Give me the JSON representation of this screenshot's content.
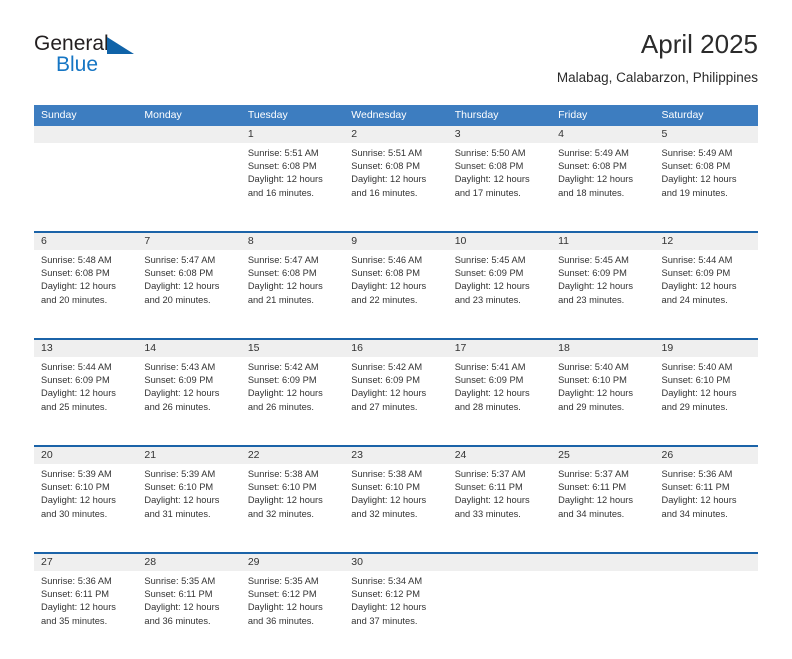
{
  "brand": {
    "name_part1": "General",
    "name_part2": "Blue"
  },
  "header": {
    "month_title": "April 2025",
    "location": "Malabag, Calabarzon, Philippines"
  },
  "colors": {
    "header_blue": "#3d7dc0",
    "divider_blue": "#1b63a8",
    "daynum_band": "#efefef",
    "logo_blue": "#1676c4",
    "text": "#333333"
  },
  "weekdays": [
    "Sunday",
    "Monday",
    "Tuesday",
    "Wednesday",
    "Thursday",
    "Friday",
    "Saturday"
  ],
  "calendar": {
    "weeks": [
      [
        {
          "day": "",
          "sunrise": "",
          "sunset": "",
          "daylight1": "",
          "daylight2": "",
          "empty": true
        },
        {
          "day": "",
          "sunrise": "",
          "sunset": "",
          "daylight1": "",
          "daylight2": "",
          "empty": true
        },
        {
          "day": "1",
          "sunrise": "Sunrise: 5:51 AM",
          "sunset": "Sunset: 6:08 PM",
          "daylight1": "Daylight: 12 hours",
          "daylight2": "and 16 minutes.",
          "empty": false
        },
        {
          "day": "2",
          "sunrise": "Sunrise: 5:51 AM",
          "sunset": "Sunset: 6:08 PM",
          "daylight1": "Daylight: 12 hours",
          "daylight2": "and 16 minutes.",
          "empty": false
        },
        {
          "day": "3",
          "sunrise": "Sunrise: 5:50 AM",
          "sunset": "Sunset: 6:08 PM",
          "daylight1": "Daylight: 12 hours",
          "daylight2": "and 17 minutes.",
          "empty": false
        },
        {
          "day": "4",
          "sunrise": "Sunrise: 5:49 AM",
          "sunset": "Sunset: 6:08 PM",
          "daylight1": "Daylight: 12 hours",
          "daylight2": "and 18 minutes.",
          "empty": false
        },
        {
          "day": "5",
          "sunrise": "Sunrise: 5:49 AM",
          "sunset": "Sunset: 6:08 PM",
          "daylight1": "Daylight: 12 hours",
          "daylight2": "and 19 minutes.",
          "empty": false
        }
      ],
      [
        {
          "day": "6",
          "sunrise": "Sunrise: 5:48 AM",
          "sunset": "Sunset: 6:08 PM",
          "daylight1": "Daylight: 12 hours",
          "daylight2": "and 20 minutes.",
          "empty": false
        },
        {
          "day": "7",
          "sunrise": "Sunrise: 5:47 AM",
          "sunset": "Sunset: 6:08 PM",
          "daylight1": "Daylight: 12 hours",
          "daylight2": "and 20 minutes.",
          "empty": false
        },
        {
          "day": "8",
          "sunrise": "Sunrise: 5:47 AM",
          "sunset": "Sunset: 6:08 PM",
          "daylight1": "Daylight: 12 hours",
          "daylight2": "and 21 minutes.",
          "empty": false
        },
        {
          "day": "9",
          "sunrise": "Sunrise: 5:46 AM",
          "sunset": "Sunset: 6:08 PM",
          "daylight1": "Daylight: 12 hours",
          "daylight2": "and 22 minutes.",
          "empty": false
        },
        {
          "day": "10",
          "sunrise": "Sunrise: 5:45 AM",
          "sunset": "Sunset: 6:09 PM",
          "daylight1": "Daylight: 12 hours",
          "daylight2": "and 23 minutes.",
          "empty": false
        },
        {
          "day": "11",
          "sunrise": "Sunrise: 5:45 AM",
          "sunset": "Sunset: 6:09 PM",
          "daylight1": "Daylight: 12 hours",
          "daylight2": "and 23 minutes.",
          "empty": false
        },
        {
          "day": "12",
          "sunrise": "Sunrise: 5:44 AM",
          "sunset": "Sunset: 6:09 PM",
          "daylight1": "Daylight: 12 hours",
          "daylight2": "and 24 minutes.",
          "empty": false
        }
      ],
      [
        {
          "day": "13",
          "sunrise": "Sunrise: 5:44 AM",
          "sunset": "Sunset: 6:09 PM",
          "daylight1": "Daylight: 12 hours",
          "daylight2": "and 25 minutes.",
          "empty": false
        },
        {
          "day": "14",
          "sunrise": "Sunrise: 5:43 AM",
          "sunset": "Sunset: 6:09 PM",
          "daylight1": "Daylight: 12 hours",
          "daylight2": "and 26 minutes.",
          "empty": false
        },
        {
          "day": "15",
          "sunrise": "Sunrise: 5:42 AM",
          "sunset": "Sunset: 6:09 PM",
          "daylight1": "Daylight: 12 hours",
          "daylight2": "and 26 minutes.",
          "empty": false
        },
        {
          "day": "16",
          "sunrise": "Sunrise: 5:42 AM",
          "sunset": "Sunset: 6:09 PM",
          "daylight1": "Daylight: 12 hours",
          "daylight2": "and 27 minutes.",
          "empty": false
        },
        {
          "day": "17",
          "sunrise": "Sunrise: 5:41 AM",
          "sunset": "Sunset: 6:09 PM",
          "daylight1": "Daylight: 12 hours",
          "daylight2": "and 28 minutes.",
          "empty": false
        },
        {
          "day": "18",
          "sunrise": "Sunrise: 5:40 AM",
          "sunset": "Sunset: 6:10 PM",
          "daylight1": "Daylight: 12 hours",
          "daylight2": "and 29 minutes.",
          "empty": false
        },
        {
          "day": "19",
          "sunrise": "Sunrise: 5:40 AM",
          "sunset": "Sunset: 6:10 PM",
          "daylight1": "Daylight: 12 hours",
          "daylight2": "and 29 minutes.",
          "empty": false
        }
      ],
      [
        {
          "day": "20",
          "sunrise": "Sunrise: 5:39 AM",
          "sunset": "Sunset: 6:10 PM",
          "daylight1": "Daylight: 12 hours",
          "daylight2": "and 30 minutes.",
          "empty": false
        },
        {
          "day": "21",
          "sunrise": "Sunrise: 5:39 AM",
          "sunset": "Sunset: 6:10 PM",
          "daylight1": "Daylight: 12 hours",
          "daylight2": "and 31 minutes.",
          "empty": false
        },
        {
          "day": "22",
          "sunrise": "Sunrise: 5:38 AM",
          "sunset": "Sunset: 6:10 PM",
          "daylight1": "Daylight: 12 hours",
          "daylight2": "and 32 minutes.",
          "empty": false
        },
        {
          "day": "23",
          "sunrise": "Sunrise: 5:38 AM",
          "sunset": "Sunset: 6:10 PM",
          "daylight1": "Daylight: 12 hours",
          "daylight2": "and 32 minutes.",
          "empty": false
        },
        {
          "day": "24",
          "sunrise": "Sunrise: 5:37 AM",
          "sunset": "Sunset: 6:11 PM",
          "daylight1": "Daylight: 12 hours",
          "daylight2": "and 33 minutes.",
          "empty": false
        },
        {
          "day": "25",
          "sunrise": "Sunrise: 5:37 AM",
          "sunset": "Sunset: 6:11 PM",
          "daylight1": "Daylight: 12 hours",
          "daylight2": "and 34 minutes.",
          "empty": false
        },
        {
          "day": "26",
          "sunrise": "Sunrise: 5:36 AM",
          "sunset": "Sunset: 6:11 PM",
          "daylight1": "Daylight: 12 hours",
          "daylight2": "and 34 minutes.",
          "empty": false
        }
      ],
      [
        {
          "day": "27",
          "sunrise": "Sunrise: 5:36 AM",
          "sunset": "Sunset: 6:11 PM",
          "daylight1": "Daylight: 12 hours",
          "daylight2": "and 35 minutes.",
          "empty": false
        },
        {
          "day": "28",
          "sunrise": "Sunrise: 5:35 AM",
          "sunset": "Sunset: 6:11 PM",
          "daylight1": "Daylight: 12 hours",
          "daylight2": "and 36 minutes.",
          "empty": false
        },
        {
          "day": "29",
          "sunrise": "Sunrise: 5:35 AM",
          "sunset": "Sunset: 6:12 PM",
          "daylight1": "Daylight: 12 hours",
          "daylight2": "and 36 minutes.",
          "empty": false
        },
        {
          "day": "30",
          "sunrise": "Sunrise: 5:34 AM",
          "sunset": "Sunset: 6:12 PM",
          "daylight1": "Daylight: 12 hours",
          "daylight2": "and 37 minutes.",
          "empty": false
        },
        {
          "day": "",
          "sunrise": "",
          "sunset": "",
          "daylight1": "",
          "daylight2": "",
          "empty": true
        },
        {
          "day": "",
          "sunrise": "",
          "sunset": "",
          "daylight1": "",
          "daylight2": "",
          "empty": true
        },
        {
          "day": "",
          "sunrise": "",
          "sunset": "",
          "daylight1": "",
          "daylight2": "",
          "empty": true
        }
      ]
    ]
  }
}
